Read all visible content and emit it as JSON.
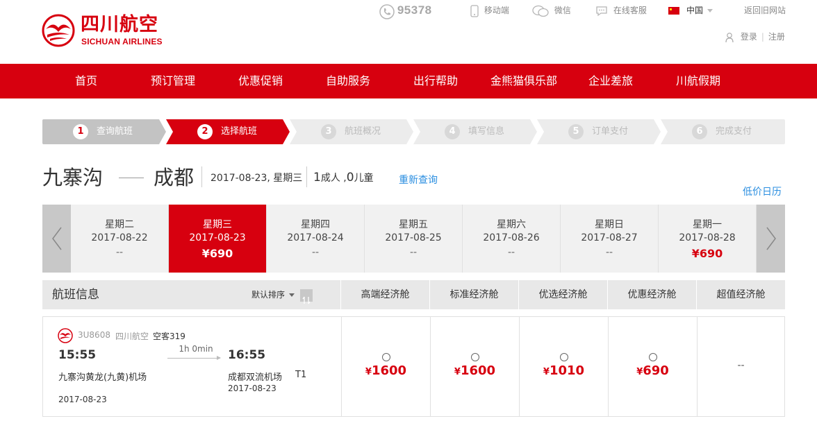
{
  "header": {
    "logo_cn": "四川航空",
    "logo_en": "SICHUAN AIRLINES",
    "hotline": "95378",
    "mobile": "移动端",
    "wechat": "微信",
    "online_service": "在线客服",
    "country": "中国",
    "old_site": "返回旧网站",
    "login": "登录",
    "register": "注册"
  },
  "nav": [
    "首页",
    "预订管理",
    "优惠促销",
    "自助服务",
    "出行帮助",
    "金熊猫俱乐部",
    "企业差旅",
    "川航假期"
  ],
  "steps": [
    {
      "num": "1",
      "label": "查询航班",
      "state": "done"
    },
    {
      "num": "2",
      "label": "选择航班",
      "state": "active"
    },
    {
      "num": "3",
      "label": "航班概况",
      "state": "todo"
    },
    {
      "num": "4",
      "label": "填写信息",
      "state": "todo"
    },
    {
      "num": "5",
      "label": "订单支付",
      "state": "todo"
    },
    {
      "num": "6",
      "label": "完成支付",
      "state": "todo"
    }
  ],
  "route": {
    "from": "九寨沟",
    "to": "成都",
    "date": "2017-08-23, 星期三",
    "adults_num": "1",
    "adults_label": "成人 ,",
    "children_num": "0",
    "children_label": "儿童",
    "requery": "重新查询",
    "low_price_calendar": "低价日历"
  },
  "datebar": [
    {
      "weekday": "星期二",
      "date": "2017-08-22",
      "price": "--"
    },
    {
      "weekday": "星期三",
      "date": "2017-08-23",
      "price": "¥690",
      "active": true
    },
    {
      "weekday": "星期四",
      "date": "2017-08-24",
      "price": "--"
    },
    {
      "weekday": "星期五",
      "date": "2017-08-25",
      "price": "--"
    },
    {
      "weekday": "星期六",
      "date": "2017-08-26",
      "price": "--"
    },
    {
      "weekday": "星期日",
      "date": "2017-08-27",
      "price": "--"
    },
    {
      "weekday": "星期一",
      "date": "2017-08-28",
      "price": "¥690"
    }
  ],
  "table": {
    "info_label": "航班信息",
    "sort_label": "默认排序",
    "columns": [
      "高端经济舱",
      "标准经济舱",
      "优选经济舱",
      "优惠经济舱",
      "超值经济舱"
    ]
  },
  "flight": {
    "number": "3U8608",
    "airline": "四川航空",
    "aircraft": "空客319",
    "dep_time": "15:55",
    "arr_time": "16:55",
    "duration": "1h 0min",
    "dep_airport": "九寨沟黄龙(九黄)机场",
    "arr_airport": "成都双流机场",
    "arr_terminal": "T1",
    "dep_date": "2017-08-23",
    "arr_date": "2017-08-23",
    "fares": [
      {
        "currency": "¥",
        "amount": "1600"
      },
      {
        "currency": "¥",
        "amount": "1600"
      },
      {
        "currency": "¥",
        "amount": "1010"
      },
      {
        "currency": "¥",
        "amount": "690"
      },
      {
        "none": "--"
      }
    ]
  },
  "colors": {
    "brand_red": "#d7000f",
    "link_blue": "#2a8ee0"
  }
}
